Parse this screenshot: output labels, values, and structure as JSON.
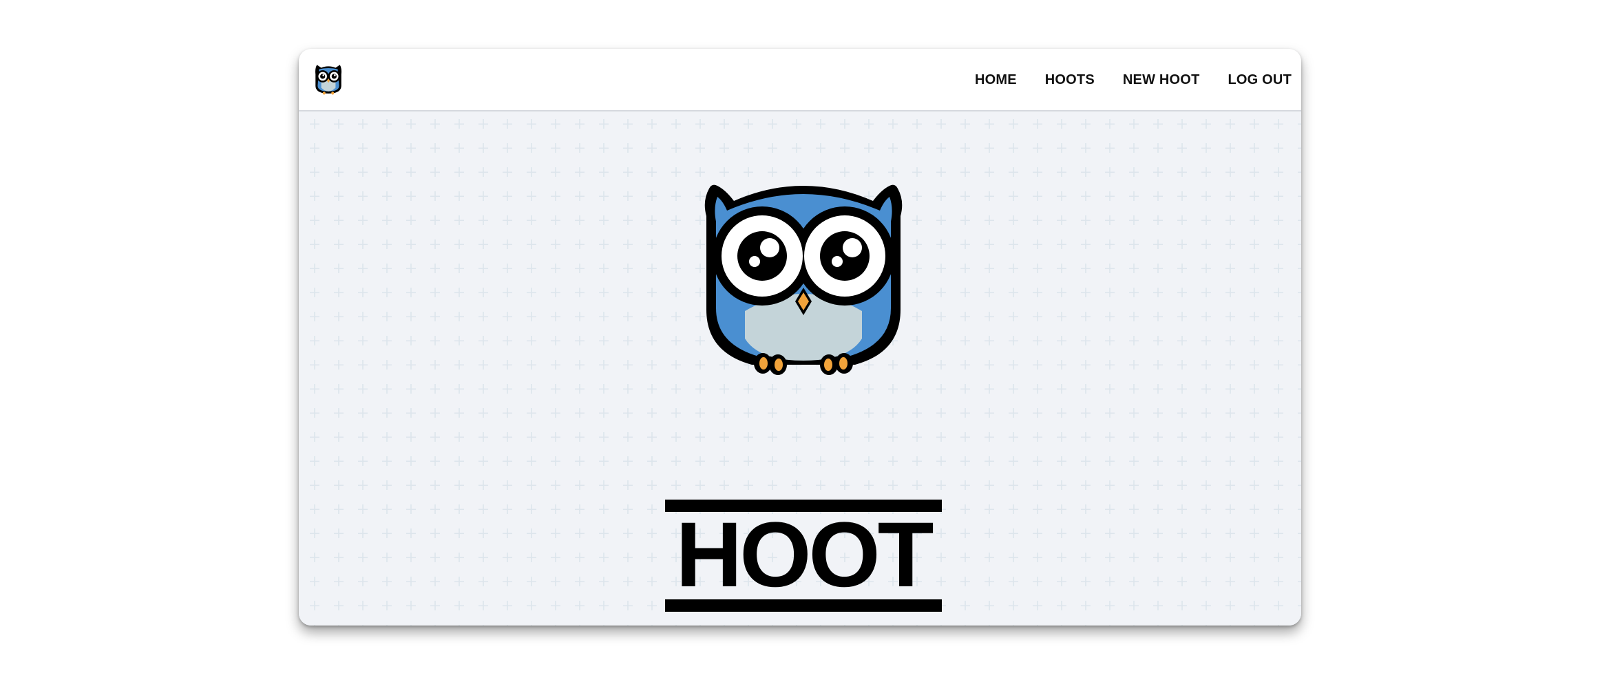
{
  "navbar": {
    "logo_icon": "owl-logo-icon",
    "links": [
      {
        "label": "HOME"
      },
      {
        "label": "HOOTS"
      },
      {
        "label": "NEW HOOT"
      },
      {
        "label": "LOG OUT"
      }
    ]
  },
  "hero": {
    "logo_icon": "owl-logo-icon",
    "wordmark": "HOOT"
  },
  "colors": {
    "owl_blue": "#4a8fd1",
    "owl_belly": "#c4d4d9",
    "owl_feet": "#f2a33a",
    "background": "#f1f3f7",
    "pattern": "#dde5ec"
  }
}
